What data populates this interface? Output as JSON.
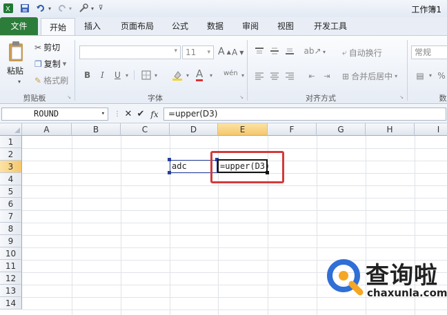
{
  "window": {
    "title": "工作簿1"
  },
  "tabs": [
    "文件",
    "开始",
    "插入",
    "页面布局",
    "公式",
    "数据",
    "审阅",
    "视图",
    "开发工具"
  ],
  "ribbon": {
    "clipboard": {
      "paste": "粘贴",
      "cut": "剪切",
      "copy": "复制",
      "format_painter": "格式刷",
      "group": "剪贴板"
    },
    "font": {
      "size": "11",
      "bold": "B",
      "italic": "I",
      "underline": "U",
      "font_color": "A",
      "increase": "A",
      "decrease": "A",
      "phonetic": "wén",
      "group": "字体"
    },
    "alignment": {
      "wrap": "自动换行",
      "merge": "合并后居中",
      "group": "对齐方式"
    },
    "number": {
      "format": "常规",
      "group": "数"
    }
  },
  "formula_bar": {
    "name_box": "ROUND",
    "fx": "fx",
    "cancel": "✕",
    "enter": "✔",
    "formula": "=upper(D3)"
  },
  "grid": {
    "columns": [
      "A",
      "B",
      "C",
      "D",
      "E",
      "F",
      "G",
      "H",
      "I"
    ],
    "rows": [
      "1",
      "2",
      "3",
      "4",
      "5",
      "6",
      "7",
      "8",
      "9",
      "10",
      "11",
      "12",
      "13",
      "14"
    ],
    "cells": {
      "D3": "adc",
      "E3": "=upper(D3)"
    },
    "active_cell": "E3"
  },
  "watermark": {
    "brand": "查询啦",
    "url": "chaxunla.com"
  },
  "colors": {
    "file_tab": "#2d7d3a",
    "highlight": "#d33a3a",
    "selected_header": "#f5c76b"
  }
}
